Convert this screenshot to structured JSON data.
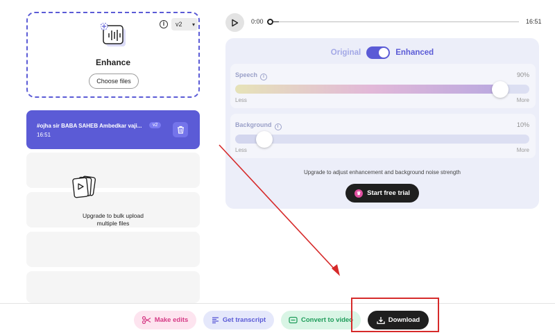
{
  "upload": {
    "title": "Enhance",
    "choose_label": "Choose files",
    "version": "v2",
    "info_glyph": "i"
  },
  "file": {
    "name": "#ojha sir BABA SAHEB Ambedkar vaji...",
    "badge": "v2",
    "duration": "16:51"
  },
  "bulk": {
    "line1": "Upgrade to bulk upload",
    "line2": "multiple files"
  },
  "player": {
    "current_time": "0:00",
    "total_time": "16:51",
    "progress_fraction": 0.01
  },
  "enhance_panel": {
    "original_label": "Original",
    "enhanced_label": "Enhanced",
    "toggle_on": true,
    "sliders": [
      {
        "name": "Speech",
        "value_label": "90%",
        "value": 0.9,
        "less": "Less",
        "more": "More"
      },
      {
        "name": "Background",
        "value_label": "10%",
        "value": 0.1,
        "less": "Less",
        "more": "More"
      }
    ],
    "upgrade_note": "Upgrade to adjust enhancement and background noise strength",
    "trial_label": "Start free trial"
  },
  "actions": {
    "make_edits": "Make edits",
    "get_transcript": "Get transcript",
    "convert_video": "Convert to video",
    "download": "Download"
  },
  "colors": {
    "accent": "#5b5bd6",
    "annotation": "#d62a2a"
  },
  "icons": {
    "upload": "audio-wave-upload-icon",
    "trash": "trash-icon",
    "bulk": "video-files-icon",
    "play": "play-icon",
    "crown": "crown-icon",
    "edits": "scissors-icon",
    "transcript": "text-lines-icon",
    "video": "video-icon",
    "download": "download-icon"
  }
}
